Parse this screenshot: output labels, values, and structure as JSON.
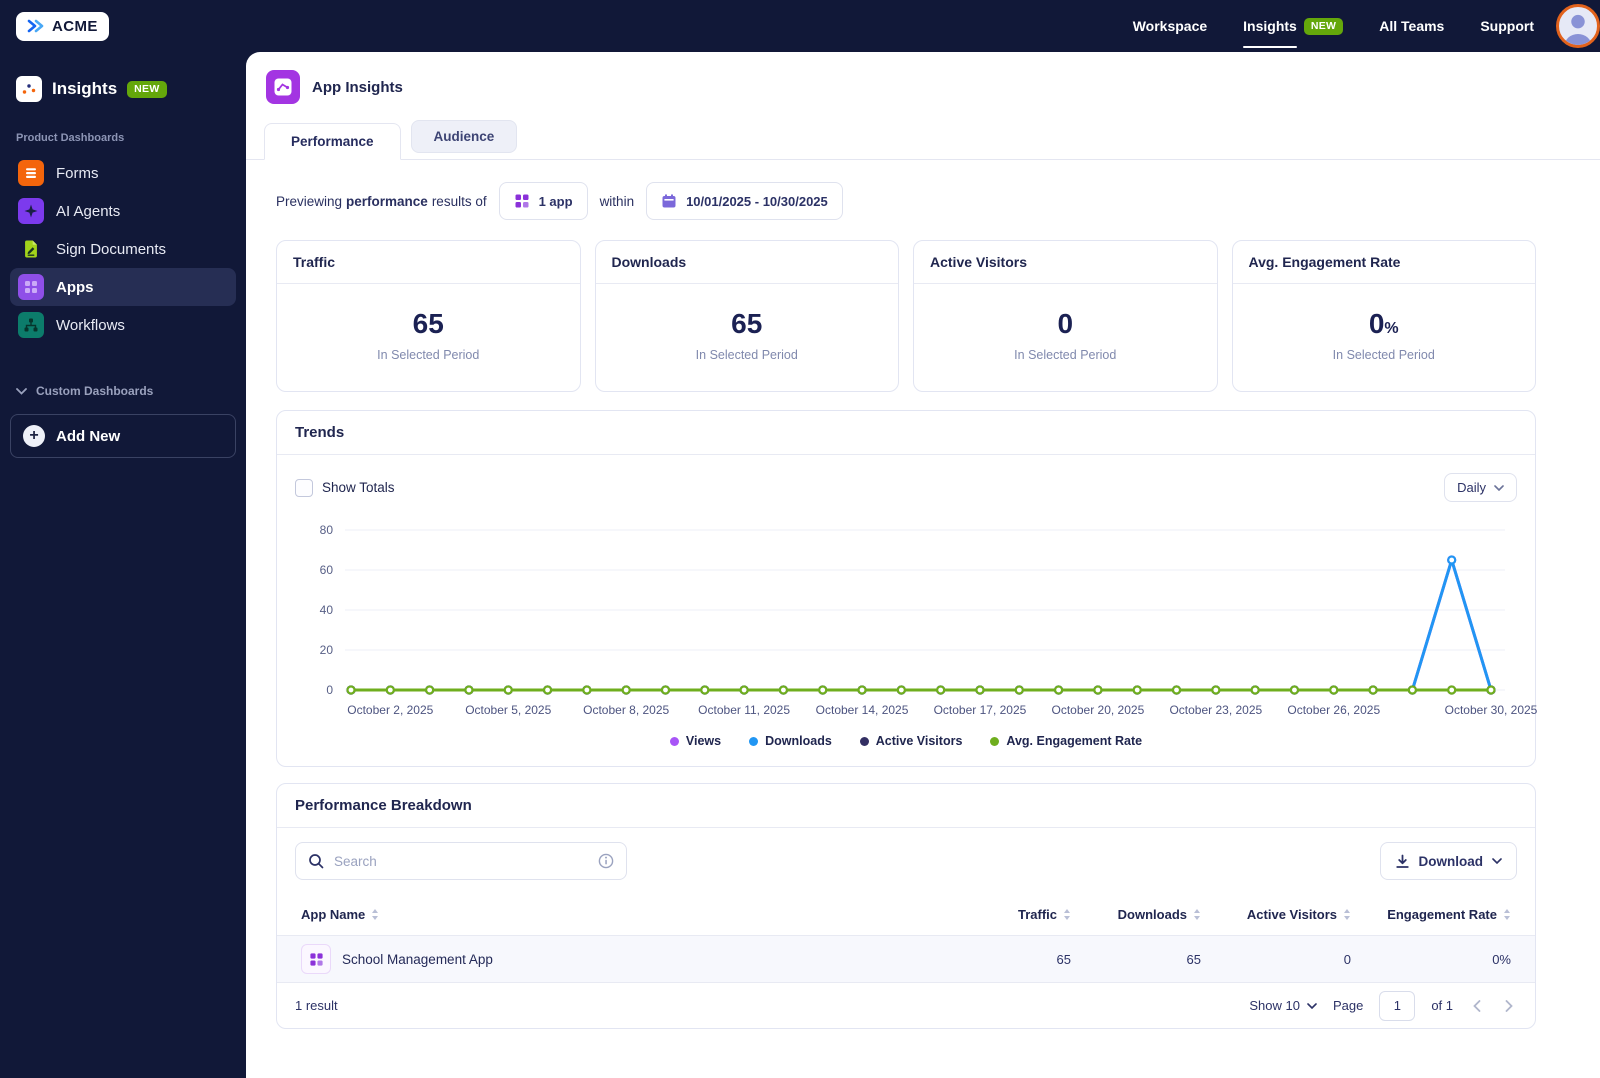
{
  "topbar": {
    "logo_text": "ACME",
    "nav": [
      {
        "label": "Workspace"
      },
      {
        "label": "Insights",
        "badge": "NEW"
      },
      {
        "label": "All Teams"
      },
      {
        "label": "Support"
      }
    ]
  },
  "sidebar": {
    "title": "Insights",
    "title_badge": "NEW",
    "section_label": "Product Dashboards",
    "items": [
      {
        "label": "Forms"
      },
      {
        "label": "AI Agents"
      },
      {
        "label": "Sign Documents"
      },
      {
        "label": "Apps"
      },
      {
        "label": "Workflows"
      }
    ],
    "custom_section_label": "Custom Dashboards",
    "add_new_label": "Add New"
  },
  "page": {
    "title": "App Insights"
  },
  "tabs": [
    {
      "label": "Performance"
    },
    {
      "label": "Audience"
    }
  ],
  "filter_bar": {
    "text_before": "Previewing",
    "text_bold": "performance",
    "text_after": "results of",
    "app_selector": "1 app",
    "within_label": "within",
    "date_range": "10/01/2025 - 10/30/2025"
  },
  "stat_cards": [
    {
      "title": "Traffic",
      "value": "65",
      "subtitle": "In Selected Period"
    },
    {
      "title": "Downloads",
      "value": "65",
      "subtitle": "In Selected Period"
    },
    {
      "title": "Active Visitors",
      "value": "0",
      "subtitle": "In Selected Period"
    },
    {
      "title": "Avg. Engagement Rate",
      "value": "0",
      "unit": "%",
      "subtitle": "In Selected Period"
    }
  ],
  "trends": {
    "title": "Trends",
    "show_totals_label": "Show Totals",
    "granularity": "Daily"
  },
  "chart_data": {
    "type": "line",
    "x_days": 30,
    "x_start": "October 1, 2025",
    "x_end": "October 30, 2025",
    "x_tick_days": [
      2,
      5,
      8,
      11,
      14,
      17,
      20,
      23,
      26,
      30
    ],
    "x_tick_labels": [
      "October 2, 2025",
      "October 5, 2025",
      "October 8, 2025",
      "October 11, 2025",
      "October 14, 2025",
      "October 17, 2025",
      "October 20, 2025",
      "October 23, 2025",
      "October 26, 2025",
      "October 30, 2025"
    ],
    "ylim": [
      0,
      80
    ],
    "yticks": [
      0,
      20,
      40,
      60,
      80
    ],
    "grid": true,
    "legend_position": "bottom",
    "series": [
      {
        "name": "Views",
        "color": "#a855f7",
        "values": [
          0,
          0,
          0,
          0,
          0,
          0,
          0,
          0,
          0,
          0,
          0,
          0,
          0,
          0,
          0,
          0,
          0,
          0,
          0,
          0,
          0,
          0,
          0,
          0,
          0,
          0,
          0,
          0,
          65,
          0
        ]
      },
      {
        "name": "Downloads",
        "color": "#2196f3",
        "values": [
          0,
          0,
          0,
          0,
          0,
          0,
          0,
          0,
          0,
          0,
          0,
          0,
          0,
          0,
          0,
          0,
          0,
          0,
          0,
          0,
          0,
          0,
          0,
          0,
          0,
          0,
          0,
          0,
          65,
          0
        ]
      },
      {
        "name": "Active Visitors",
        "color": "#332f63",
        "values": [
          0,
          0,
          0,
          0,
          0,
          0,
          0,
          0,
          0,
          0,
          0,
          0,
          0,
          0,
          0,
          0,
          0,
          0,
          0,
          0,
          0,
          0,
          0,
          0,
          0,
          0,
          0,
          0,
          0,
          0
        ]
      },
      {
        "name": "Avg. Engagement Rate",
        "color": "#6fae1e",
        "values": [
          0,
          0,
          0,
          0,
          0,
          0,
          0,
          0,
          0,
          0,
          0,
          0,
          0,
          0,
          0,
          0,
          0,
          0,
          0,
          0,
          0,
          0,
          0,
          0,
          0,
          0,
          0,
          0,
          0,
          0
        ]
      }
    ]
  },
  "breakdown": {
    "title": "Performance Breakdown",
    "search_placeholder": "Search",
    "download_label": "Download",
    "columns": [
      "App Name",
      "Traffic",
      "Downloads",
      "Active Visitors",
      "Engagement Rate"
    ],
    "rows": [
      {
        "app_name": "School Management App",
        "traffic": "65",
        "downloads": "65",
        "active_visitors": "0",
        "engagement_rate": "0%"
      }
    ],
    "footer": {
      "results_text": "1 result",
      "show_label": "Show 10",
      "page_label": "Page",
      "page_value": "1",
      "of_text": "of 1"
    }
  },
  "colors": {
    "topbar_bg": "#111838",
    "accent_purple": "#a335e2",
    "badge_green": "#64a70b",
    "chart_blue": "#2196f3",
    "chart_purple": "#a855f7",
    "chart_navy": "#332f63",
    "chart_green": "#6fae1e",
    "avatar_ring_orange": "#e2621c"
  }
}
